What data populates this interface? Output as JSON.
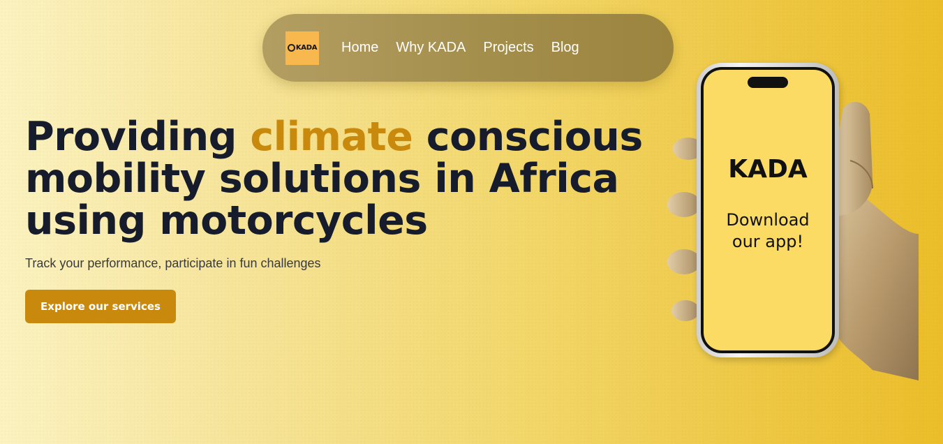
{
  "nav": {
    "logo_text": "KADA",
    "links": [
      {
        "label": "Home"
      },
      {
        "label": "Why KADA"
      },
      {
        "label": "Projects"
      },
      {
        "label": "Blog"
      }
    ]
  },
  "hero": {
    "headline_before": "Providing ",
    "headline_accent": "climate",
    "headline_after": " conscious mobility solutions in Africa using motorcycles",
    "subtitle": "Track your performance, participate in fun challenges",
    "cta_label": "Explore our services"
  },
  "phone": {
    "app_name": "KADA",
    "app_cta": "Download our app!"
  },
  "colors": {
    "accent": "#c8890c",
    "headline": "#161c2b",
    "nav_bg": "#a48e4c",
    "logo_bg": "#f8b84e",
    "screen_bg": "#fbdb63"
  }
}
